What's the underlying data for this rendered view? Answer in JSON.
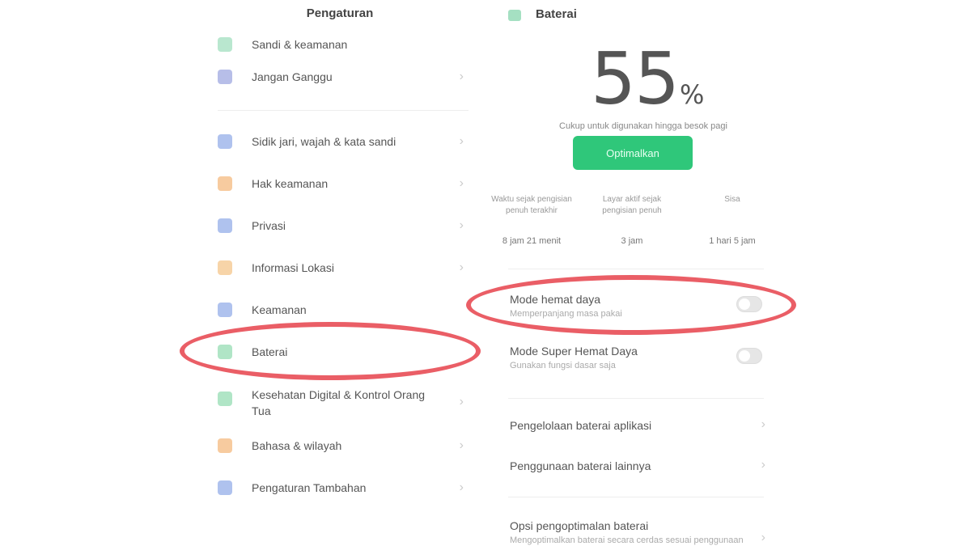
{
  "left": {
    "title": "Pengaturan",
    "cut_item": "Sandi & keamanan",
    "items": [
      {
        "label": "Jangan Ganggu",
        "icon": "moon-icon",
        "color": "#7c88d6"
      },
      {
        "label": "Sidik jari, wajah & kata sandi",
        "icon": "fingerprint-icon",
        "color": "#6d8fe0"
      },
      {
        "label": "Hak keamanan",
        "icon": "shield-icon",
        "color": "#f0a050"
      },
      {
        "label": "Privasi",
        "icon": "privacy-icon",
        "color": "#6d8fe0"
      },
      {
        "label": "Informasi Lokasi",
        "icon": "location-icon",
        "color": "#f0b060"
      },
      {
        "label": "Keamanan",
        "icon": "lock-icon",
        "color": "#6d8fe0"
      },
      {
        "label": "Baterai",
        "icon": "battery-icon",
        "color": "#6fcf97"
      },
      {
        "label": "Kesehatan Digital & Kontrol Orang Tua",
        "icon": "digital-wellbeing-icon",
        "color": "#6fcf97"
      },
      {
        "label": "Bahasa & wilayah",
        "icon": "language-icon",
        "color": "#f0a050"
      },
      {
        "label": "Pengaturan Tambahan",
        "icon": "more-settings-icon",
        "color": "#6d8fe0"
      }
    ]
  },
  "right": {
    "title": "Baterai",
    "percent": "55",
    "percent_sign": "%",
    "status": "Cukup untuk digunakan hingga besok pagi",
    "optimize_button": "Optimalkan",
    "stats": [
      {
        "caption": "Waktu sejak pengisian penuh terakhir",
        "value": "8 jam 21 menit"
      },
      {
        "caption": "Layar aktif sejak pengisian penuh",
        "value": "3 jam"
      },
      {
        "caption": "Sisa",
        "value": "1 hari 5 jam"
      }
    ],
    "modes": [
      {
        "title": "Mode hemat daya",
        "sub": "Memperpanjang masa pakai"
      },
      {
        "title": "Mode Super Hemat Daya",
        "sub": "Gunakan fungsi dasar saja"
      }
    ],
    "links": [
      {
        "title": "Pengelolaan baterai aplikasi"
      },
      {
        "title": "Penggunaan baterai lainnya"
      }
    ],
    "bottom": {
      "title": "Opsi pengoptimalan baterai",
      "sub": "Mengoptimalkan baterai secara cerdas sesuai penggunaan"
    }
  },
  "colors": {
    "highlight": "#e84d55",
    "accent_green": "#2fc77a"
  }
}
